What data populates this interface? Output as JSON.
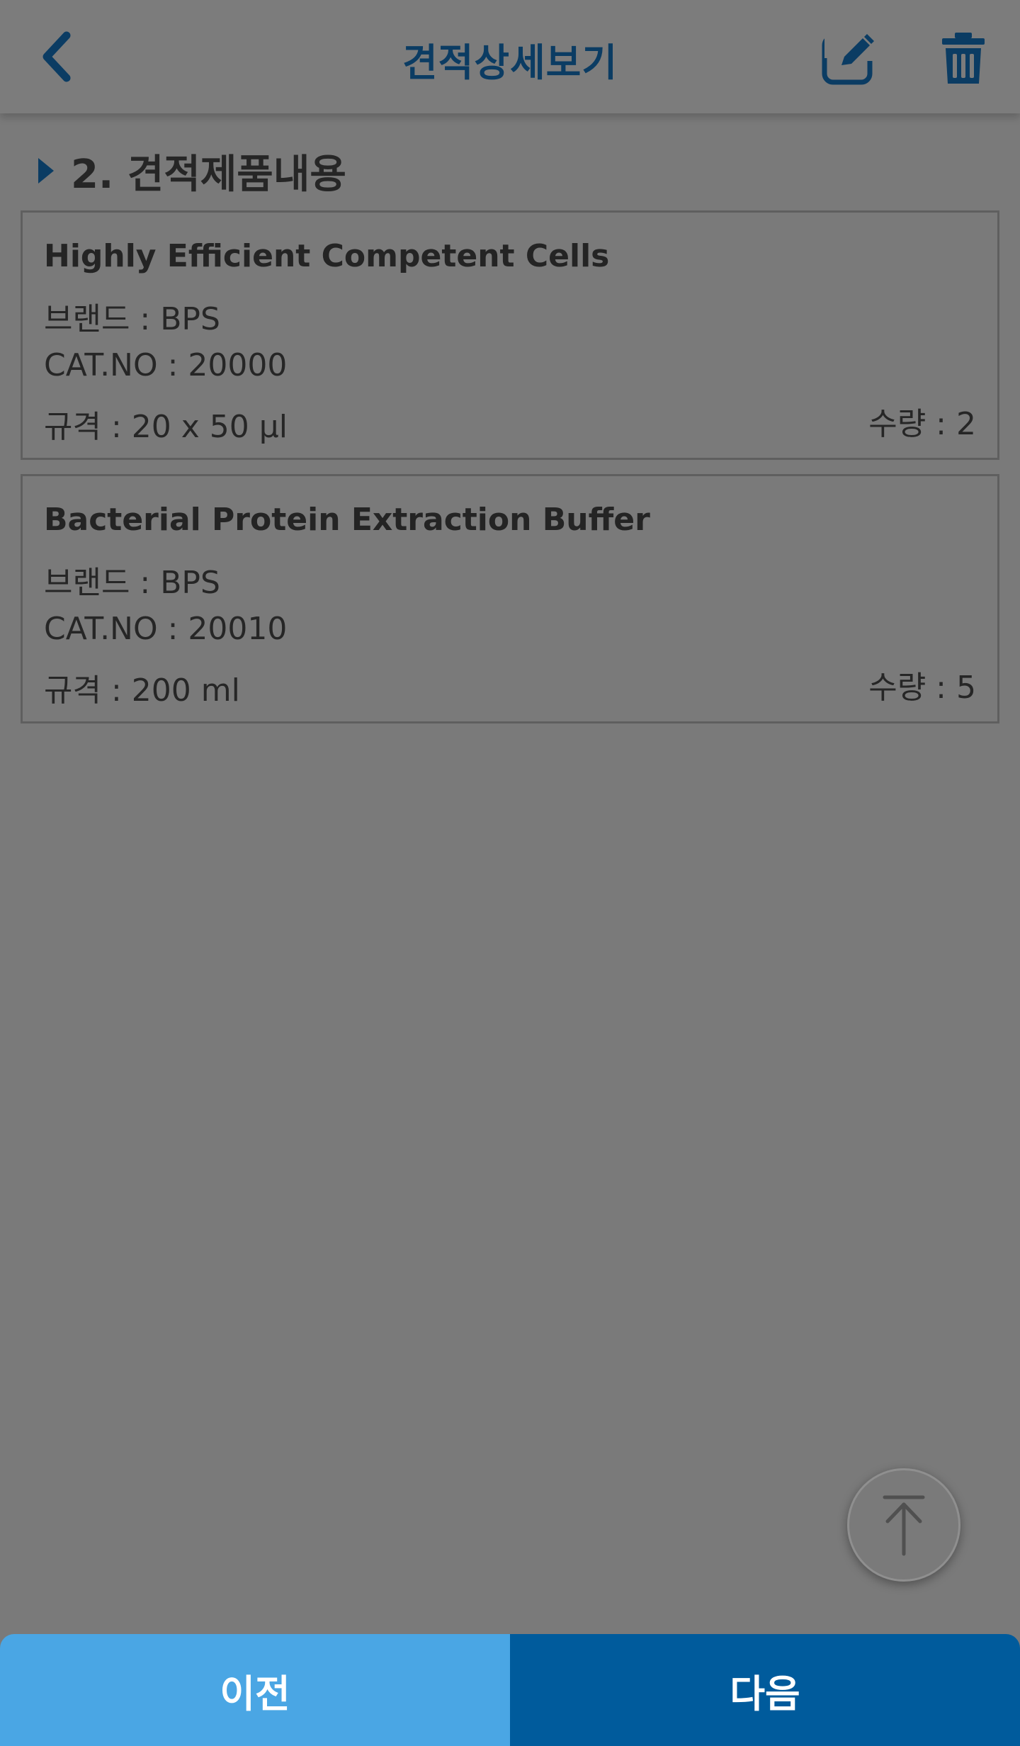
{
  "header": {
    "title": "견적상세보기"
  },
  "section": {
    "title": "2. 견적제품내용"
  },
  "items": [
    {
      "name": "Highly Efficient Competent Cells",
      "brand": "브랜드 : BPS",
      "cat_no": "CAT.NO : 20000",
      "spec": "규격 : 20 x 50 μl",
      "quantity": "수량 : 2"
    },
    {
      "name": "Bacterial Protein Extraction Buffer",
      "brand": "브랜드 : BPS",
      "cat_no": "CAT.NO : 20010",
      "spec": "규격 : 200 ml",
      "quantity": "수량 : 5"
    }
  ],
  "footer": {
    "prev_label": "이전",
    "next_label": "다음"
  },
  "colors": {
    "accent_dark": "#005b9c",
    "accent_light": "#4aa6e4",
    "title_color": "#0b3c63",
    "overlay_bg": "#7a7a7a"
  },
  "icons": {
    "back": "chevron-left-icon",
    "edit": "edit-icon",
    "delete": "trash-icon",
    "scroll_top": "arrow-up-icon"
  }
}
